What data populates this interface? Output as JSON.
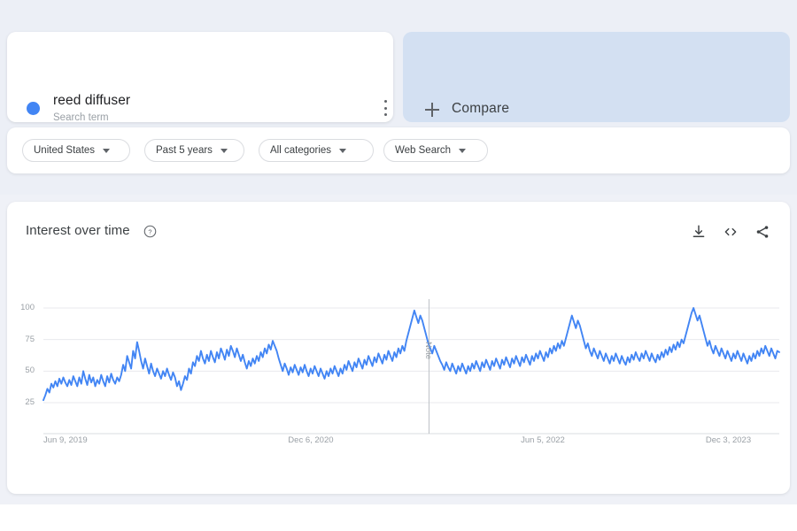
{
  "topbar": {
    "term": {
      "name": "reed diffuser",
      "subtitle": "Search term",
      "dot_color": "#4285f4",
      "menu_icon": "more-vert-icon"
    },
    "compare": {
      "label": "Compare",
      "plus_icon": "plus-icon",
      "bg_color": "#d3e0f2"
    }
  },
  "filters": [
    {
      "label": "United States",
      "caret_icon": "chevron-down-icon"
    },
    {
      "label": "Past 5 years",
      "caret_icon": "chevron-down-icon"
    },
    {
      "label": "All categories",
      "caret_icon": "chevron-down-icon"
    },
    {
      "label": "Web Search",
      "caret_icon": "chevron-down-icon"
    }
  ],
  "chart_panel": {
    "title": "Interest over time",
    "help_icon": "help-circle-icon",
    "actions": [
      {
        "name": "download-icon",
        "label": "Download"
      },
      {
        "name": "embed-code-icon",
        "label": "Embed"
      },
      {
        "name": "share-icon",
        "label": "Share"
      }
    ]
  },
  "chart_data": {
    "type": "line",
    "title": "Interest over time",
    "xlabel": "",
    "ylabel": "",
    "ylim": [
      0,
      100
    ],
    "yticks": [
      25,
      50,
      75,
      100
    ],
    "xtick_labels": [
      "Jun 9, 2019",
      "Dec 6, 2020",
      "Jun 5, 2022",
      "Dec 3, 2023"
    ],
    "xtick_positions": [
      0.0,
      0.3325,
      0.6488,
      0.9
    ],
    "grid": true,
    "legend": "none",
    "line_color": "#4285f4",
    "annotations": [
      {
        "type": "vline",
        "label": "Note",
        "x_frac": 0.524
      }
    ],
    "series": [
      {
        "name": "reed diffuser",
        "color": "#4285f4",
        "values": [
          27,
          31,
          36,
          33,
          40,
          37,
          42,
          38,
          44,
          40,
          45,
          41,
          38,
          43,
          39,
          46,
          42,
          38,
          45,
          40,
          50,
          44,
          39,
          47,
          41,
          45,
          38,
          43,
          40,
          47,
          42,
          38,
          46,
          41,
          48,
          43,
          40,
          45,
          42,
          47,
          55,
          50,
          62,
          57,
          52,
          66,
          60,
          73,
          66,
          58,
          52,
          60,
          54,
          48,
          56,
          50,
          46,
          52,
          48,
          44,
          50,
          46,
          52,
          47,
          43,
          49,
          45,
          38,
          42,
          35,
          40,
          46,
          43,
          52,
          48,
          57,
          54,
          62,
          58,
          66,
          60,
          56,
          63,
          58,
          66,
          61,
          57,
          65,
          60,
          68,
          64,
          59,
          67,
          62,
          70,
          66,
          61,
          68,
          63,
          58,
          63,
          57,
          52,
          58,
          54,
          60,
          56,
          62,
          58,
          65,
          61,
          68,
          64,
          71,
          67,
          74,
          70,
          66,
          60,
          55,
          50,
          56,
          52,
          47,
          53,
          49,
          55,
          51,
          47,
          53,
          49,
          55,
          50,
          46,
          52,
          48,
          54,
          50,
          46,
          52,
          48,
          44,
          50,
          46,
          52,
          48,
          54,
          50,
          46,
          52,
          48,
          55,
          51,
          58,
          54,
          50,
          57,
          53,
          60,
          56,
          52,
          59,
          55,
          62,
          58,
          54,
          61,
          57,
          64,
          60,
          56,
          63,
          59,
          66,
          62,
          58,
          65,
          61,
          68,
          64,
          70,
          66,
          74,
          80,
          86,
          92,
          98,
          93,
          88,
          94,
          90,
          84,
          78,
          72,
          68,
          64,
          70,
          66,
          62,
          58,
          55,
          51,
          57,
          53,
          50,
          56,
          52,
          48,
          54,
          50,
          56,
          52,
          48,
          54,
          50,
          56,
          52,
          58,
          54,
          50,
          57,
          53,
          59,
          55,
          51,
          58,
          54,
          60,
          56,
          52,
          59,
          55,
          61,
          57,
          53,
          60,
          56,
          62,
          58,
          54,
          61,
          57,
          63,
          59,
          55,
          62,
          58,
          64,
          60,
          66,
          62,
          58,
          65,
          61,
          68,
          64,
          70,
          66,
          72,
          68,
          74,
          70,
          76,
          82,
          88,
          94,
          89,
          84,
          90,
          86,
          80,
          74,
          68,
          72,
          66,
          62,
          68,
          64,
          60,
          66,
          62,
          58,
          64,
          60,
          56,
          62,
          58,
          64,
          60,
          56,
          62,
          58,
          55,
          61,
          57,
          63,
          59,
          65,
          61,
          58,
          64,
          60,
          66,
          62,
          58,
          64,
          60,
          57,
          63,
          59,
          65,
          61,
          67,
          63,
          69,
          65,
          71,
          67,
          73,
          69,
          75,
          72,
          78,
          84,
          90,
          96,
          100,
          95,
          90,
          94,
          88,
          82,
          76,
          70,
          74,
          68,
          64,
          70,
          66,
          62,
          68,
          64,
          60,
          66,
          62,
          58,
          64,
          60,
          66,
          62,
          58,
          64,
          60,
          56,
          62,
          58,
          64,
          60,
          66,
          62,
          68,
          64,
          70,
          66,
          62,
          68,
          64,
          60,
          66,
          65
        ]
      }
    ]
  }
}
